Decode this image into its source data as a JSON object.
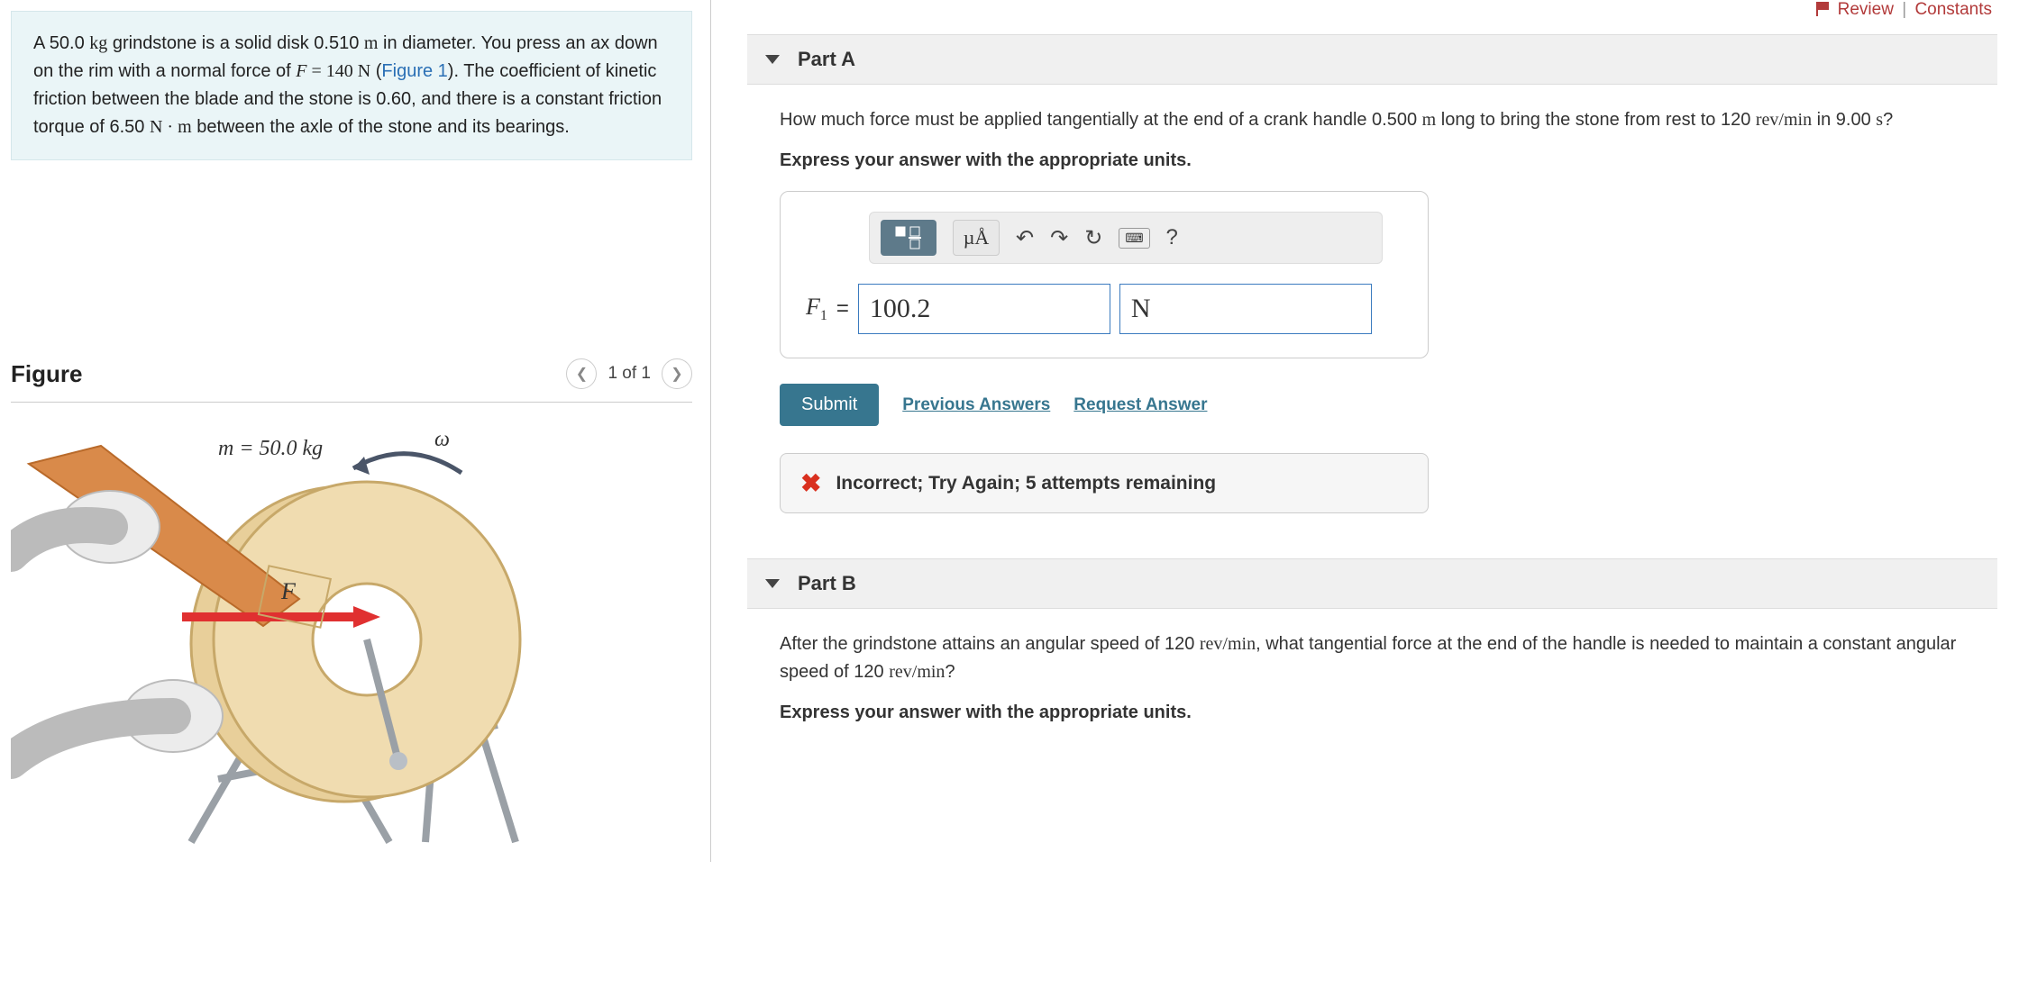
{
  "top_links": {
    "review": "Review",
    "constants": "Constants"
  },
  "problem": {
    "line1_a": "A 50.0 ",
    "line1_unit1": "kg",
    "line1_b": " grindstone is a solid disk 0.510 ",
    "line1_unit2": "m",
    "line1_c": " in diameter. You press an ax down on the rim with a normal force of ",
    "line1_F": "F",
    "line1_eq": " = 140 ",
    "line1_unit3": "N",
    "line1_d": " (",
    "figure_link": "Figure 1",
    "line1_e": "). The coefficient of kinetic friction between the blade and the stone is 0.60, and there is a constant friction torque of 6.50 ",
    "line1_unit4": "N · m",
    "line1_f": " between the axle of the stone and its bearings."
  },
  "figure": {
    "title": "Figure",
    "counter": "1 of 1",
    "mass_label": "m = 50.0 kg",
    "force_label": "F",
    "omega_label": "ω"
  },
  "partA": {
    "title": "Part A",
    "q1": "How much force must be applied tangentially at the end of a crank handle 0.500 ",
    "q_unit1": "m",
    "q2": " long to bring the stone from rest to 120 ",
    "q_unit2": "rev/min",
    "q3": " in 9.00 ",
    "q_unit3": "s",
    "q4": "?",
    "instruction": "Express your answer with the appropriate units.",
    "toolbar_mu": "µÅ",
    "answer_symbol": "F",
    "answer_sub": "1",
    "answer_eq": " = ",
    "value": "100.2",
    "unit": "N",
    "submit": "Submit",
    "prev": "Previous Answers",
    "request": "Request Answer",
    "feedback": "Incorrect; Try Again; 5 attempts remaining"
  },
  "partB": {
    "title": "Part B",
    "q1": "After the grindstone attains an angular speed of 120 ",
    "q_unit1": "rev/min",
    "q2": ", what tangential force at the end of the handle is needed to maintain a constant angular speed of 120 ",
    "q_unit2": "rev/min",
    "q3": "?",
    "instruction": "Express your answer with the appropriate units."
  }
}
